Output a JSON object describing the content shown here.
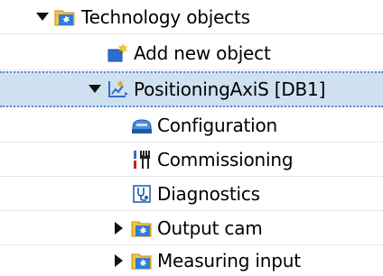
{
  "tree": {
    "technology_objects": {
      "label": "Technology objects",
      "icon": "technology-folder-icon",
      "expanded": true
    },
    "add_new_object": {
      "label": "Add new object",
      "icon": "add-new-object-icon"
    },
    "positioning_axis": {
      "label": "PositioningAxiS [DB1]",
      "icon": "positioning-axis-icon",
      "expanded": true,
      "selected": true
    },
    "configuration": {
      "label": "Configuration",
      "icon": "configuration-icon"
    },
    "commissioning": {
      "label": "Commissioning",
      "icon": "commissioning-icon"
    },
    "diagnostics": {
      "label": "Diagnostics",
      "icon": "diagnostics-icon"
    },
    "output_cam": {
      "label": "Output cam",
      "icon": "technology-folder-icon",
      "expanded": false
    },
    "measuring_input": {
      "label": "Measuring input",
      "icon": "technology-folder-icon",
      "expanded": false
    }
  },
  "colors": {
    "selection": "#cfe0f1",
    "selection_border": "#5b8ccc",
    "row_separator": "#e3e7ec"
  }
}
